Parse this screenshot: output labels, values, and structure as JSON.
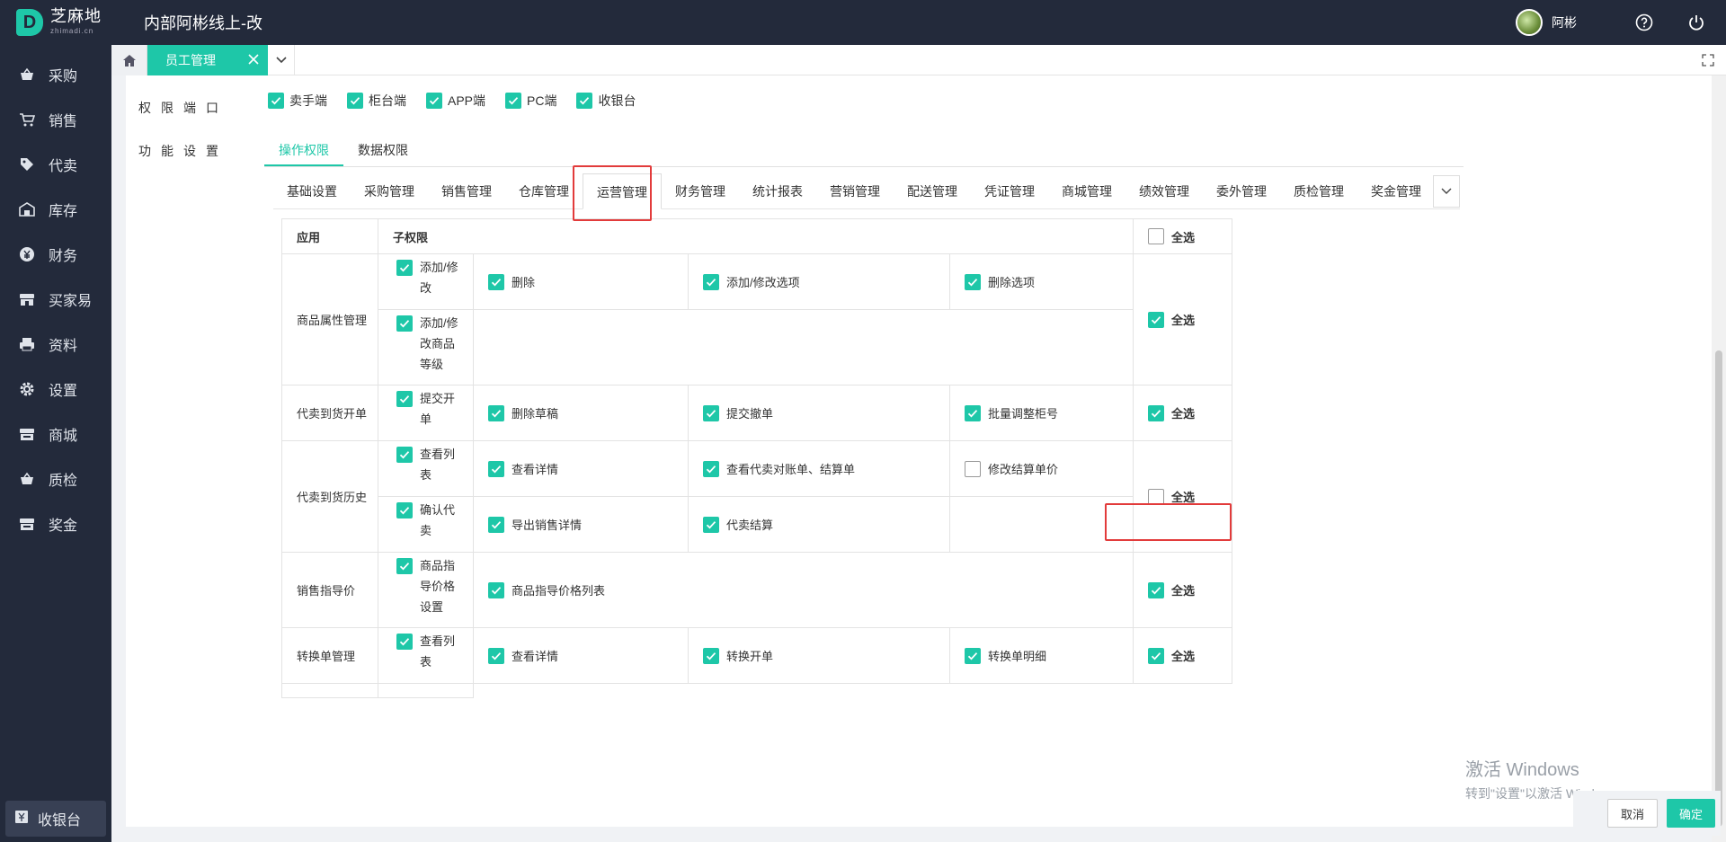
{
  "header": {
    "logo_cn": "芝麻地",
    "logo_en": "zhimadi.cn",
    "app_title": "内部阿彬线上-改",
    "username": "阿彬"
  },
  "sidebar": {
    "items": [
      {
        "label": "采购",
        "icon": "basket-icon"
      },
      {
        "label": "销售",
        "icon": "cart-icon"
      },
      {
        "label": "代卖",
        "icon": "tag-icon"
      },
      {
        "label": "库存",
        "icon": "warehouse-icon"
      },
      {
        "label": "财务",
        "icon": "yen-icon"
      },
      {
        "label": "买家易",
        "icon": "store-icon"
      },
      {
        "label": "资料",
        "icon": "printer-icon"
      },
      {
        "label": "设置",
        "icon": "gear-icon"
      },
      {
        "label": "商城",
        "icon": "shop-icon"
      },
      {
        "label": "质检",
        "icon": "basket-icon"
      },
      {
        "label": "奖金",
        "icon": "store-icon"
      }
    ],
    "bottom_label": "收银台"
  },
  "tabbar": {
    "active_tab": "员工管理"
  },
  "form": {
    "label_ports": "权限端口",
    "label_features": "功能设置",
    "ports": [
      {
        "label": "卖手端",
        "checked": true
      },
      {
        "label": "柜台端",
        "checked": true
      },
      {
        "label": "APP端",
        "checked": true
      },
      {
        "label": "PC端",
        "checked": true
      },
      {
        "label": "收银台",
        "checked": true
      }
    ],
    "perm_tabs": [
      "操作权限",
      "数据权限"
    ],
    "module_tabs": [
      "基础设置",
      "采购管理",
      "销售管理",
      "仓库管理",
      "运营管理",
      "财务管理",
      "统计报表",
      "营销管理",
      "配送管理",
      "凭证管理",
      "商城管理",
      "绩效管理",
      "委外管理",
      "质检管理",
      "奖金管理"
    ],
    "active_module": "运营管理"
  },
  "table": {
    "col_app": "应用",
    "col_sub": "子权限",
    "select_all": "全选",
    "rows": [
      {
        "app": "商品属性管理",
        "all": true,
        "lines": [
          {
            "main": "添加/修改",
            "items": [
              {
                "label": "删除",
                "checked": true
              },
              {
                "label": "添加/修改选项",
                "checked": true
              },
              {
                "label": "删除选项",
                "checked": true
              }
            ]
          },
          {
            "main": "添加/修改商品等级",
            "items": []
          }
        ]
      },
      {
        "app": "代卖到货开单",
        "all": true,
        "lines": [
          {
            "main": "提交开单",
            "items": [
              {
                "label": "删除草稿",
                "checked": true
              },
              {
                "label": "提交撤单",
                "checked": true
              },
              {
                "label": "批量调整柜号",
                "checked": true
              }
            ]
          }
        ]
      },
      {
        "app": "代卖到货历史",
        "all": false,
        "lines": [
          {
            "main": "查看列表",
            "items": [
              {
                "label": "查看详情",
                "checked": true
              },
              {
                "label": "查看代卖对账单、结算单",
                "checked": true
              },
              {
                "label": "修改结算单价",
                "checked": false
              }
            ]
          },
          {
            "main": "确认代卖",
            "items": [
              {
                "label": "导出销售详情",
                "checked": true
              },
              {
                "label": "代卖结算",
                "checked": true
              }
            ]
          }
        ]
      },
      {
        "app": "销售指导价",
        "all": true,
        "lines": [
          {
            "main": "商品指导价格设置",
            "items": [
              {
                "label": "商品指导价格列表",
                "checked": true
              }
            ]
          }
        ]
      },
      {
        "app": "转换单管理",
        "all": true,
        "lines": [
          {
            "main": "查看列表",
            "items": [
              {
                "label": "查看详情",
                "checked": true
              },
              {
                "label": "转换开单",
                "checked": true
              },
              {
                "label": "转换单明细",
                "checked": true
              }
            ]
          }
        ]
      }
    ]
  },
  "buttons": {
    "cancel": "取消",
    "confirm": "确定"
  },
  "watermark": {
    "line1": "激活 Windows",
    "line2": "转到\"设置\"以激活 Windows。"
  },
  "colors": {
    "accent": "#1ec7a8",
    "sidebar_bg": "#232a3b",
    "highlight": "#e23b3b"
  }
}
